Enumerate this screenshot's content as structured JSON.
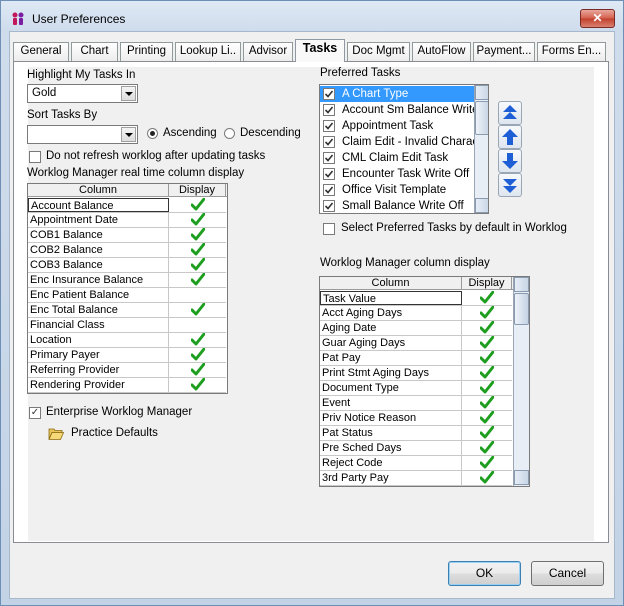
{
  "window": {
    "title": "User Preferences",
    "close_glyph": "✕"
  },
  "tabs": [
    {
      "label": "General"
    },
    {
      "label": "Chart"
    },
    {
      "label": "Printing"
    },
    {
      "label": "Lookup Li.."
    },
    {
      "label": "Advisor"
    },
    {
      "label": "Tasks"
    },
    {
      "label": "Doc Mgmt"
    },
    {
      "label": "AutoFlow"
    },
    {
      "label": "Payment..."
    },
    {
      "label": "Forms En..."
    }
  ],
  "active_tab": "Tasks",
  "left": {
    "highlight_label": "Highlight My Tasks In",
    "highlight_value": "Gold",
    "sort_label": "Sort Tasks By",
    "sort_value": "",
    "ascending_label": "Ascending",
    "descending_label": "Descending",
    "sort_direction": "Ascending",
    "no_refresh_label": "Do not refresh worklog after updating tasks",
    "no_refresh_checked": false,
    "grid_title": "Worklog Manager real time column display",
    "grid_col1": "Column",
    "grid_col2": "Display",
    "grid_rows": [
      {
        "name": "Account Balance",
        "display": true
      },
      {
        "name": "Appointment Date",
        "display": true
      },
      {
        "name": "COB1 Balance",
        "display": true
      },
      {
        "name": "COB2 Balance",
        "display": true
      },
      {
        "name": "COB3 Balance",
        "display": true
      },
      {
        "name": "Enc Insurance Balance",
        "display": true
      },
      {
        "name": "Enc Patient Balance",
        "display": false
      },
      {
        "name": "Enc Total Balance",
        "display": true
      },
      {
        "name": "Financial Class",
        "display": false
      },
      {
        "name": "Location",
        "display": true
      },
      {
        "name": "Primary Payer",
        "display": true
      },
      {
        "name": "Referring Provider",
        "display": true
      },
      {
        "name": "Rendering Provider",
        "display": true
      }
    ],
    "enterprise_label": "Enterprise Worklog Manager",
    "enterprise_checked": true,
    "practice_defaults_label": "Practice Defaults"
  },
  "right": {
    "preferred_label": "Preferred Tasks",
    "preferred_items": [
      {
        "label": "A Chart Type",
        "checked": true,
        "selected": true
      },
      {
        "label": "Account Sm Balance Write",
        "checked": true
      },
      {
        "label": "Appointment Task",
        "checked": true
      },
      {
        "label": "Claim Edit - Invalid Charact",
        "checked": true
      },
      {
        "label": "CML Claim Edit Task",
        "checked": true
      },
      {
        "label": "Encounter Task Write Off",
        "checked": true
      },
      {
        "label": "Office Visit Template",
        "checked": true
      },
      {
        "label": "Small Balance Write Off",
        "checked": true
      }
    ],
    "select_default_label": "Select Preferred Tasks by default in Worklog",
    "select_default_checked": false,
    "grid_title": "Worklog Manager column display",
    "grid_col1": "Column",
    "grid_col2": "Display",
    "grid_rows": [
      {
        "name": "Task Value",
        "display": true
      },
      {
        "name": "Acct Aging Days",
        "display": true
      },
      {
        "name": "Aging Date",
        "display": true
      },
      {
        "name": "Guar Aging Days",
        "display": true
      },
      {
        "name": "Pat Pay",
        "display": true
      },
      {
        "name": "Print Stmt Aging Days",
        "display": true
      },
      {
        "name": "Document Type",
        "display": true
      },
      {
        "name": "Event",
        "display": true
      },
      {
        "name": "Priv Notice Reason",
        "display": true
      },
      {
        "name": "Pat Status",
        "display": true
      },
      {
        "name": "Pre Sched Days",
        "display": true
      },
      {
        "name": "Reject Code",
        "display": true
      },
      {
        "name": "3rd Party Pay",
        "display": true
      }
    ]
  },
  "footer": {
    "ok_label": "OK",
    "cancel_label": "Cancel"
  },
  "colors": {
    "selection": "#3399ff",
    "check_green": "#1e9e1e",
    "arrow_blue": "#1f5fd6"
  }
}
